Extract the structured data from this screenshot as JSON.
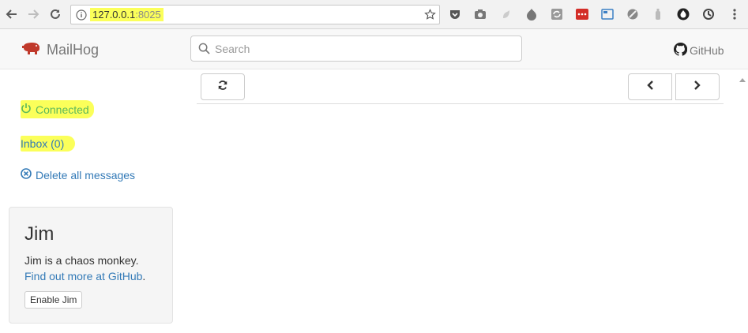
{
  "browser": {
    "url_host": "127.0.0.1",
    "url_port": ":8025"
  },
  "navbar": {
    "brand": "MailHog",
    "search_placeholder": "Search",
    "github_label": "GitHub"
  },
  "sidebar": {
    "connected_label": "Connected",
    "inbox_label": "Inbox (0)",
    "delete_label": "Delete all messages"
  },
  "jim": {
    "title": "Jim",
    "description": "Jim is a chaos monkey.",
    "link_text": "Find out more at GitHub",
    "link_suffix": ".",
    "enable_button": "Enable Jim"
  },
  "colors": {
    "highlight": "#fbff5a",
    "connected_green": "#5cb85c",
    "link_blue": "#337ab7",
    "brand_red": "#c0392b"
  }
}
